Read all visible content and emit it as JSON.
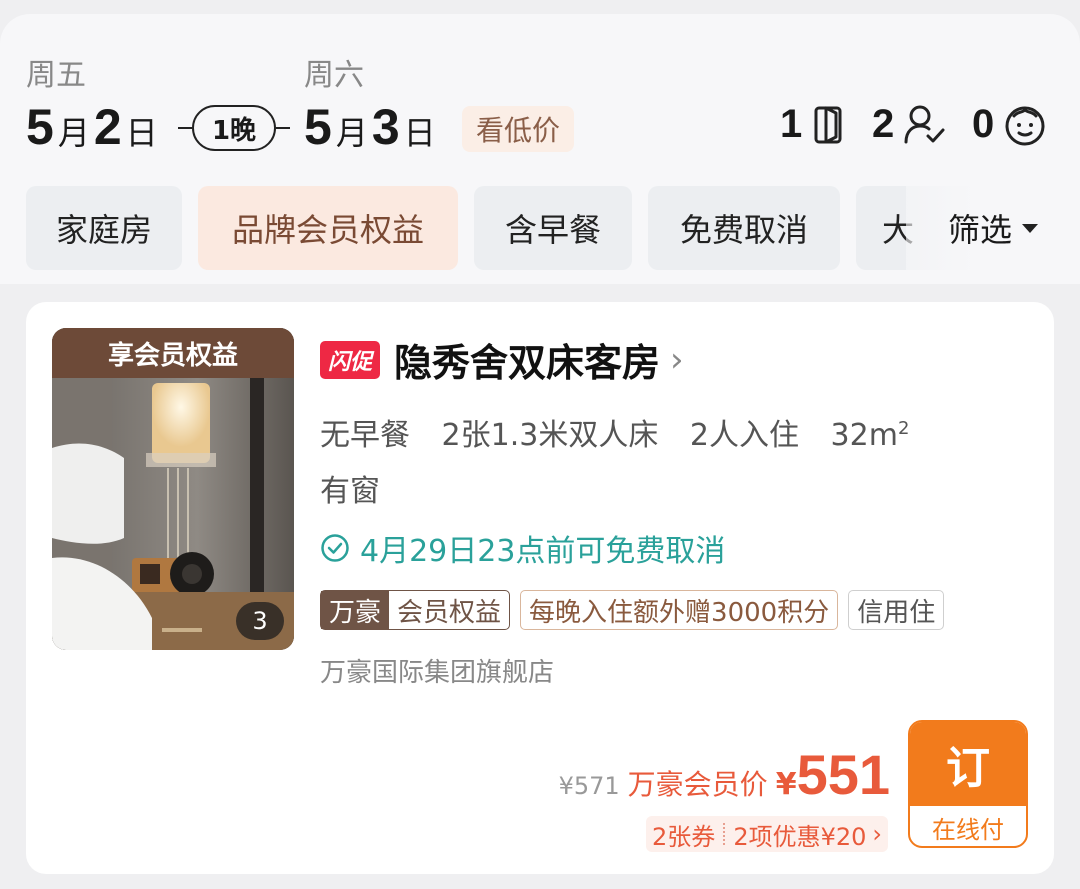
{
  "search": {
    "checkin": {
      "weekday": "周五",
      "month": "5",
      "month_unit": "月",
      "day": "2",
      "day_unit": "日"
    },
    "checkout": {
      "weekday": "周六",
      "month": "5",
      "month_unit": "月",
      "day": "3",
      "day_unit": "日"
    },
    "nights": "1晚",
    "low_price_label": "看低价",
    "rooms": "1",
    "adults": "2",
    "children": "0"
  },
  "filters": {
    "chips": [
      "家庭房",
      "品牌会员权益",
      "含早餐",
      "免费取消",
      "大"
    ],
    "filter_label": "筛选"
  },
  "room_card": {
    "image_badge": "享会员权益",
    "image_count": "3",
    "flash_tag": "闪促",
    "name": "隐秀舍双床客房",
    "specs": [
      "无早餐",
      "2张1.3米双人床",
      "2人入住"
    ],
    "area": "32m",
    "area_sup": "2",
    "window": "有窗",
    "cancel_text": "4月29日23点前可免费取消",
    "tags": {
      "brand": "万豪",
      "brand_benefit": "会员权益",
      "points": "每晚入住额外赠3000积分",
      "credit": "信用住"
    },
    "store": "万豪国际集团旗舰店",
    "original_price": "¥571",
    "member_price_label": "万豪会员价",
    "currency": "¥",
    "price": "551",
    "coupons": "2张券",
    "discounts": "2项优惠¥20",
    "book_label": "订",
    "pay_label": "在线付"
  },
  "colors": {
    "accent_orange": "#f27b1c",
    "price_red": "#e85a3b",
    "teal": "#2aa19a",
    "brand_brown": "#6f5446"
  }
}
